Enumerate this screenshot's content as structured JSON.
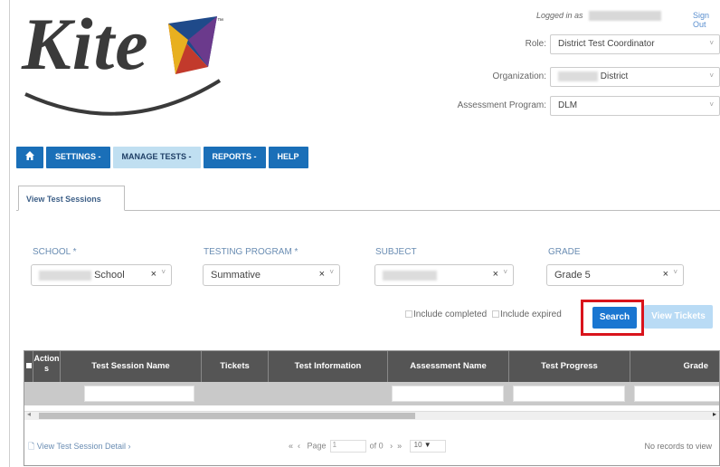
{
  "header": {
    "logo_text": "Kite",
    "logged_in_prefix": "Logged in as",
    "sign_out": "Sign Out",
    "role_label": "Role:",
    "role_value": "District Test Coordinator",
    "org_label": "Organization:",
    "org_value": "District",
    "program_label": "Assessment Program:",
    "program_value": "DLM"
  },
  "nav": {
    "home_icon": "home-icon",
    "settings": "SETTINGS -",
    "manage_tests": "MANAGE TESTS -",
    "reports": "REPORTS -",
    "help": "HELP"
  },
  "tabs": {
    "view_test_sessions": "View Test Sessions"
  },
  "filters": {
    "school_label": "SCHOOL *",
    "school_value": "School",
    "program_label": "TESTING PROGRAM *",
    "program_value": "Summative",
    "subject_label": "SUBJECT",
    "subject_value": "",
    "grade_label": "GRADE",
    "grade_value": "Grade 5",
    "clear_glyph": "×",
    "caret_glyph": "˅"
  },
  "options": {
    "include_completed": "Include completed",
    "include_expired": "Include expired",
    "search": "Search",
    "view_tickets": "View Tickets"
  },
  "grid": {
    "columns": [
      "Action s",
      "Test Session Name",
      "Tickets",
      "Test Information",
      "Assessment Name",
      "Test Progress",
      "Grade"
    ],
    "view_detail": "View Test Session Detail",
    "page_label": "Page",
    "page_value": "1",
    "of_label": "of 0",
    "rows_value": "10",
    "no_records": "No records to view"
  },
  "colors": {
    "nav_blue": "#1a6fb8",
    "nav_active": "#c0dff1",
    "highlight_red": "#d9141c",
    "grid_header": "#555555"
  }
}
